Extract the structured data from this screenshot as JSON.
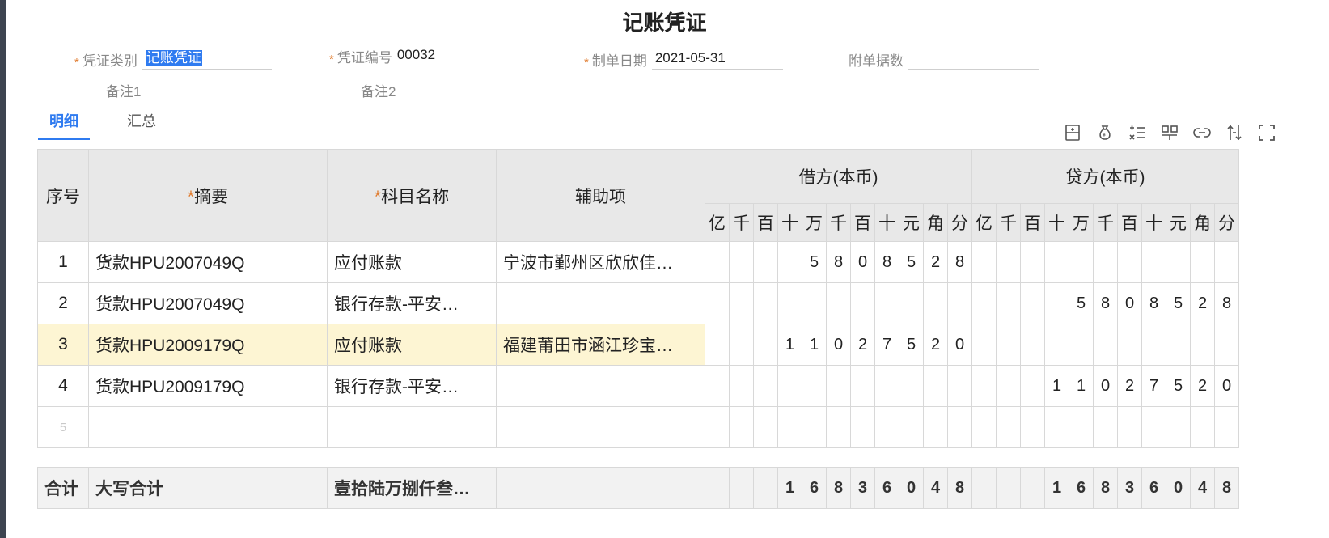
{
  "title": "记账凭证",
  "form": {
    "voucher_type_label": "凭证类别",
    "voucher_type_value": "记账凭证",
    "voucher_no_label": "凭证编号",
    "voucher_no_value": "00032",
    "date_label": "制单日期",
    "date_value": "2021-05-31",
    "attachments_label": "附单据数",
    "attachments_value": "",
    "note1_label": "备注1",
    "note1_value": "",
    "note2_label": "备注2",
    "note2_value": "",
    "required_mark": "*"
  },
  "tabs": [
    {
      "label": "明细",
      "active": true
    },
    {
      "label": "汇总",
      "active": false
    }
  ],
  "toolbar_icons": [
    "insert-row-icon",
    "money-bag-icon",
    "list-formula-icon",
    "split-icon",
    "link-icon",
    "adjust-icon",
    "fullscreen-icon"
  ],
  "table": {
    "headers": {
      "seq": "序号",
      "summary": "摘要",
      "account": "科目名称",
      "aux": "辅助项",
      "debit": "借方(本币)",
      "credit": "贷方(本币)",
      "digits": [
        "亿",
        "千",
        "百",
        "十",
        "万",
        "千",
        "百",
        "十",
        "元",
        "角",
        "分"
      ]
    },
    "rows": [
      {
        "seq": "1",
        "summary": "货款HPU2007049Q",
        "account": "应付账款",
        "aux": "宁波市鄞州区欣欣佳…",
        "debit": [
          "",
          "",
          "",
          "",
          "5",
          "8",
          "0",
          "8",
          "5",
          "2",
          "8"
        ],
        "credit": [
          "",
          "",
          "",
          "",
          "",
          "",
          "",
          "",
          "",
          "",
          ""
        ]
      },
      {
        "seq": "2",
        "summary": "货款HPU2007049Q",
        "account": "银行存款-平安…",
        "aux": "",
        "debit": [
          "",
          "",
          "",
          "",
          "",
          "",
          "",
          "",
          "",
          "",
          ""
        ],
        "credit": [
          "",
          "",
          "",
          "",
          "5",
          "8",
          "0",
          "8",
          "5",
          "2",
          "8"
        ]
      },
      {
        "seq": "3",
        "summary": "货款HPU2009179Q",
        "account": "应付账款",
        "aux": "福建莆田市涵江珍宝…",
        "debit": [
          "",
          "",
          "",
          "1",
          "1",
          "0",
          "2",
          "7",
          "5",
          "2",
          "0"
        ],
        "credit": [
          "",
          "",
          "",
          "",
          "",
          "",
          "",
          "",
          "",
          "",
          ""
        ]
      },
      {
        "seq": "4",
        "summary": "货款HPU2009179Q",
        "account": "银行存款-平安…",
        "aux": "",
        "debit": [
          "",
          "",
          "",
          "",
          "",
          "",
          "",
          "",
          "",
          "",
          ""
        ],
        "credit": [
          "",
          "",
          "",
          "1",
          "1",
          "0",
          "2",
          "7",
          "5",
          "2",
          "0"
        ]
      },
      {
        "seq": "5",
        "summary": "",
        "account": "",
        "aux": "",
        "debit": [
          "",
          "",
          "",
          "",
          "",
          "",
          "",
          "",
          "",
          "",
          ""
        ],
        "credit": [
          "",
          "",
          "",
          "",
          "",
          "",
          "",
          "",
          "",
          "",
          ""
        ]
      }
    ],
    "highlight_row": 2
  },
  "totals": {
    "label": "合计",
    "caps_label": "大写合计",
    "caps_value": "壹拾陆万捌仟叁…",
    "debit": [
      "",
      "",
      "",
      "1",
      "6",
      "8",
      "3",
      "6",
      "0",
      "4",
      "8"
    ],
    "credit": [
      "",
      "",
      "",
      "1",
      "6",
      "8",
      "3",
      "6",
      "0",
      "4",
      "8"
    ]
  },
  "colors": {
    "accent": "#2f7bf0",
    "highlight_row": "#fdf5d3",
    "required": "#e07a2c"
  }
}
